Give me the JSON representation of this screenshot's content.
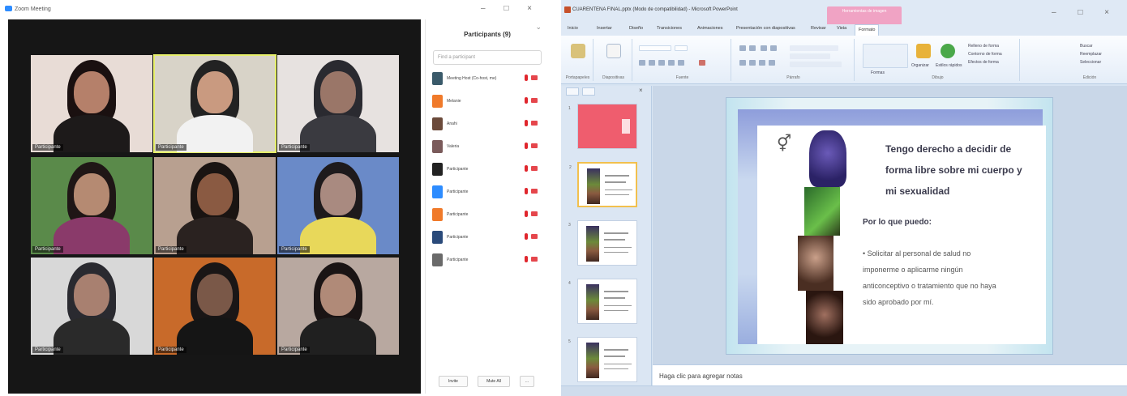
{
  "zoom": {
    "title": "Zoom Meeting",
    "window_controls": [
      "–",
      "□",
      "×"
    ],
    "participants_panel": {
      "title": "Participants (9)",
      "search_placeholder": "Find a participant",
      "participants": [
        {
          "name": "Meeting Host (Co-host, me)",
          "color": "#3a5a6a"
        },
        {
          "name": "Melanie",
          "color": "#f07a2a"
        },
        {
          "name": "Anahi",
          "color": "#6b4a3a"
        },
        {
          "name": "Valeria",
          "color": "#7a5a5a"
        },
        {
          "name": "Participante",
          "color": "#222222"
        },
        {
          "name": "Participante",
          "color": "#2d8cff"
        },
        {
          "name": "Participante",
          "color": "#f07a2a"
        },
        {
          "name": "Participante",
          "color": "#2a4a7a"
        },
        {
          "name": "Participante",
          "color": "#6a6a6a"
        }
      ],
      "invite_label": "Invite",
      "mute_all_label": "Mute All",
      "more_label": "..."
    },
    "tiles": [
      {
        "name": "Participante",
        "bg": "#e8dcd6",
        "skin": "#b5806a",
        "hair": "#1a1010",
        "shirt": "#1d1a1a",
        "active": false
      },
      {
        "name": "Participante",
        "bg": "#d8d3c8",
        "skin": "#c99a80",
        "hair": "#222",
        "shirt": "#f2f2f2",
        "active": true
      },
      {
        "name": "Participante",
        "bg": "#e7e2e0",
        "skin": "#9a7668",
        "hair": "#2a2a30",
        "shirt": "#3a3a40",
        "active": false
      },
      {
        "name": "Participante",
        "bg": "#5a8a4a",
        "skin": "#b58a72",
        "hair": "#1f1616",
        "shirt": "#8a3a6a",
        "active": false
      },
      {
        "name": "Participante",
        "bg": "#b8a090",
        "skin": "#8a5a42",
        "hair": "#1a1412",
        "shirt": "#2a2220",
        "active": false
      },
      {
        "name": "Participante",
        "bg": "#6a8ac8",
        "skin": "#a98a80",
        "hair": "#1e1a1c",
        "shirt": "#e8d85a",
        "active": false
      },
      {
        "name": "Participante",
        "bg": "#d8d8d8",
        "skin": "#a88070",
        "hair": "#2a2a30",
        "shirt": "#2a2a2a",
        "active": false
      },
      {
        "name": "Participante",
        "bg": "#c86a2a",
        "skin": "#7a5848",
        "hair": "#1a1616",
        "shirt": "#151515",
        "active": false
      },
      {
        "name": "Participante",
        "bg": "#b8a8a0",
        "skin": "#b08a78",
        "hair": "#1a1414",
        "shirt": "#202020",
        "active": false
      }
    ]
  },
  "ppt": {
    "window_title": "CUARENTENA FINAL.pptx (Modo de compatibilidad) - Microsoft PowerPoint",
    "contextual_tab": "Herramientas de imagen",
    "window_controls": [
      "–",
      "□",
      "×"
    ],
    "tabs": [
      "Inicio",
      "Insertar",
      "Diseño",
      "Transiciones",
      "Animaciones",
      "Presentación con diapositivas",
      "Revisar",
      "Vista",
      "Formato"
    ],
    "ribbon_groups": [
      "Portapapeles",
      "Diapositivas",
      "Fuente",
      "Párrafo",
      "Dibujo",
      "Edición"
    ],
    "ribbon_labels": {
      "shapes": "Formas",
      "arrange": "Organizar",
      "quick_styles": "Estilos rápidos",
      "fill": "Relleno de forma",
      "outline": "Contorno de forma",
      "effects": "Efectos de forma",
      "find": "Buscar",
      "replace": "Reemplazar",
      "select": "Seleccionar"
    },
    "slide": {
      "title": "Tengo derecho a decidir de forma libre sobre mi cuerpo y mi sexualidad",
      "subtitle": "Por lo que puedo:",
      "bullet": "Solicitar al personal de salud no imponerme o aplicarme ningún anticonceptivo o tratamiento que no haya sido aprobado por mí."
    },
    "thumbnails": [
      {
        "num": "1",
        "kind": "red"
      },
      {
        "num": "2",
        "kind": "content"
      },
      {
        "num": "3",
        "kind": "content"
      },
      {
        "num": "4",
        "kind": "content"
      },
      {
        "num": "5",
        "kind": "content"
      }
    ],
    "selected_thumbnail": 2,
    "notes_placeholder": "Haga clic para agregar notas",
    "colors": {
      "ribbon_bg": "#e4edf8",
      "contextual_tab": "#f0a3c4",
      "selected_thumb_border": "#f2c04d",
      "zoom_active_speaker": "#e6ef6a"
    }
  }
}
